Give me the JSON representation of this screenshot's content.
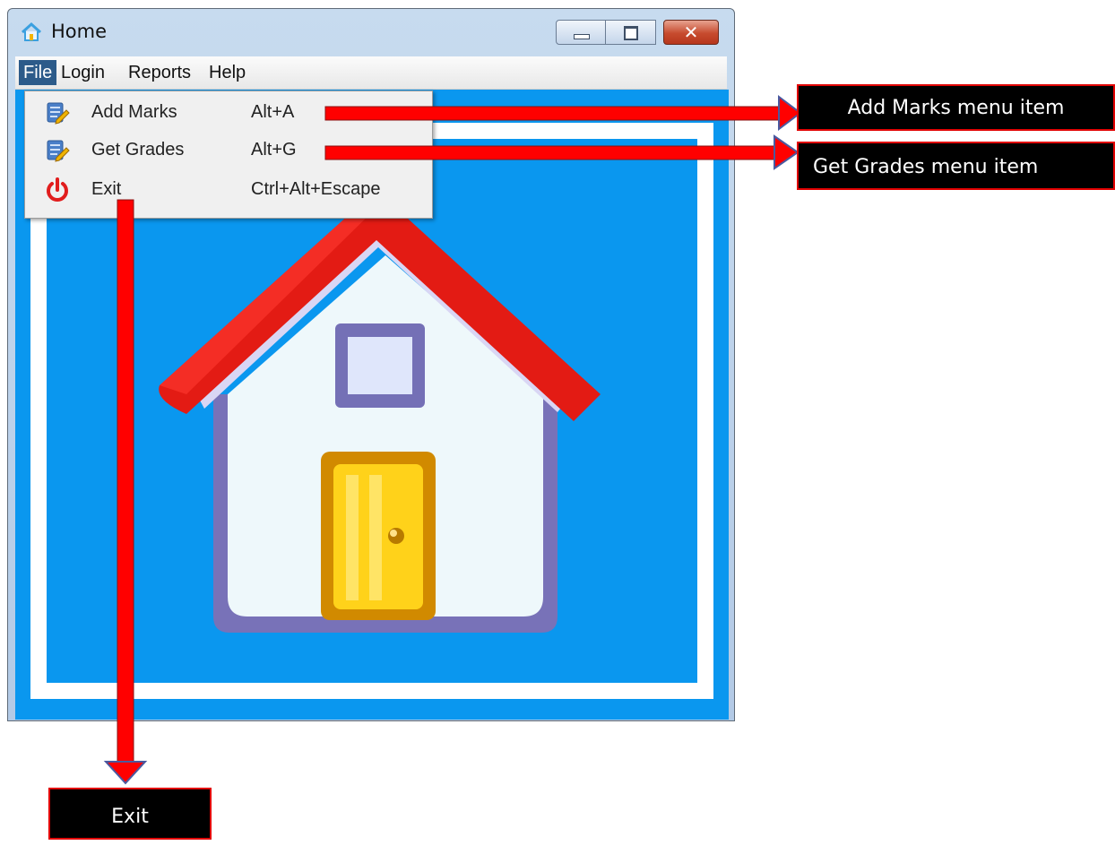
{
  "window": {
    "title": "Home",
    "icon": "home-icon",
    "controls": [
      "minimize-icon",
      "maximize-icon",
      "close-icon"
    ]
  },
  "menubar": {
    "items": [
      {
        "label": "File",
        "active": true
      },
      {
        "label": "Login"
      },
      {
        "label": "Reports"
      },
      {
        "label": "Help"
      }
    ]
  },
  "file_menu": {
    "items": [
      {
        "label": "Add Marks",
        "accelerator": "Alt+A",
        "icon": "edit-document-icon"
      },
      {
        "label": "Get Grades",
        "accelerator": "Alt+G",
        "icon": "edit-document-icon"
      },
      {
        "label": "Exit",
        "accelerator": "Ctrl+Alt+Escape",
        "icon": "power-icon"
      }
    ]
  },
  "content": {
    "image": "house-illustration",
    "background": "#0a97ef"
  },
  "annotations": {
    "add_marks": "Add Marks menu item",
    "get_grades": "Get Grades menu item",
    "exit": "Exit"
  },
  "colors": {
    "arrow": "#ff0000",
    "callout_bg": "#000000",
    "callout_border": "#e10000",
    "menu_highlight": "#2c5b8a"
  }
}
